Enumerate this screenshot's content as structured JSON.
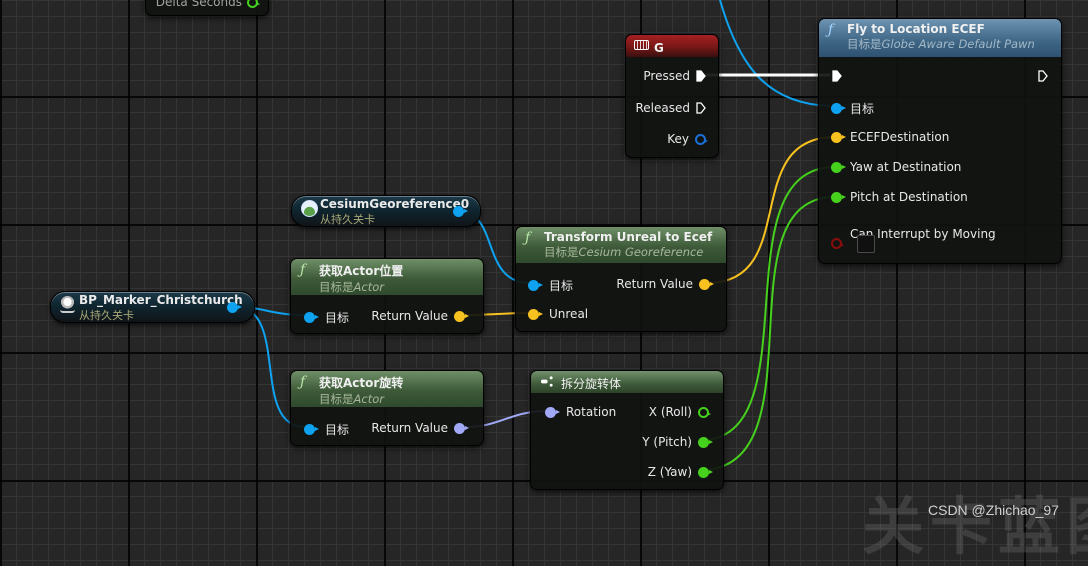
{
  "colors": {
    "object_pin": "#0ea2f0",
    "vector_pin": "#f7c21f",
    "float_pin": "#45d11c",
    "rotator_pin": "#a1a8f5",
    "bool_pin": "#8a0d0d",
    "key_struct_pin": "#1a6fd6",
    "exec_wire": "#ffffff"
  },
  "nodes": {
    "partial_top": {
      "pin_label": "Delta Seconds"
    },
    "key_g": {
      "title": "G",
      "icon": "keyboard-icon",
      "pins": {
        "pressed": "Pressed",
        "released": "Released",
        "key": "Key"
      }
    },
    "fly_to_location": {
      "title": "Fly to Location ECEF",
      "target_prefix": "目标是",
      "target_class": "Globe Aware Default Pawn",
      "pins": {
        "target": "目标",
        "ecef_destination": "ECEFDestination",
        "yaw": "Yaw at Destination",
        "pitch": "Pitch at Destination",
        "can_interrupt": "Can Interrupt by Moving"
      },
      "can_interrupt_checked": false
    },
    "cesium_georef_var": {
      "title": "CesiumGeoreference0",
      "subtitle": "从持久关卡"
    },
    "bp_marker_var": {
      "title": "BP_Marker_Christchurch",
      "subtitle": "从持久关卡"
    },
    "get_actor_location": {
      "title": "获取Actor位置",
      "target_prefix": "目标是",
      "target_class": "Actor",
      "pins": {
        "target": "目标",
        "return": "Return Value"
      }
    },
    "transform_unreal_to_ecef": {
      "title": "Transform Unreal to Ecef",
      "target_prefix": "目标是",
      "target_class": "Cesium Georeference",
      "pins": {
        "target": "目标",
        "unreal": "Unreal",
        "return": "Return Value"
      }
    },
    "get_actor_rotation": {
      "title": "获取Actor旋转",
      "target_prefix": "目标是",
      "target_class": "Actor",
      "pins": {
        "target": "目标",
        "return": "Return Value"
      }
    },
    "break_rotator": {
      "title": "拆分旋转体",
      "pins": {
        "rotation": "Rotation",
        "x": "X (Roll)",
        "y": "Y (Pitch)",
        "z": "Z (Yaw)"
      }
    }
  },
  "watermark": {
    "big": "关卡蓝图",
    "credit": "CSDN @Zhichao_97"
  }
}
